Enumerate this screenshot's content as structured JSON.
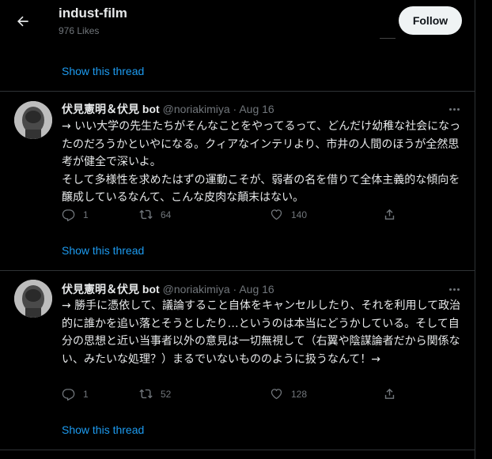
{
  "header": {
    "title": "indust-film",
    "likes": "976 Likes",
    "follow_label": "Follow"
  },
  "top": {
    "show_thread": "Show this thread"
  },
  "tweets": [
    {
      "name": "伏見憲明＆伏見 bot",
      "handle": "@noriakimiya · Aug 16",
      "text": "→ いい大学の先生たちがそんなことをやってるって、どんだけ幼稚な社会になったのだろうかといやになる。クィアなインテリより、市井の人間のほうが全然思考が健全で深いよ。\nそして多様性を求めたはずの運動こそが、弱者の名を借りて全体主義的な傾向を醸成しているなんて、こんな皮肉な顛末はない。",
      "reply_count": "1",
      "retweet_count": "64",
      "like_count": "140",
      "show_thread": "Show this thread"
    },
    {
      "name": "伏見憲明＆伏見 bot",
      "handle": "@noriakimiya · Aug 16",
      "text": "→ 勝手に憑依して、議論すること自体をキャンセルしたり、それを利用して政治的に誰かを追い落とそうとしたり…というのは本当にどうかしている。そして自分の思想と近い当事者以外の意見は一切無視して（右翼や陰謀論者だから関係ない、みたいな処理？）まるでいないもののように扱うなんて！→",
      "reply_count": "1",
      "retweet_count": "52",
      "like_count": "128",
      "show_thread": "Show this thread"
    }
  ],
  "icons": [
    "back-arrow-icon",
    "reply-icon",
    "retweet-icon",
    "like-icon",
    "share-icon",
    "more-icon"
  ],
  "colors": {
    "background": "#000000",
    "accent": "#1d9bf0",
    "muted": "#71767b",
    "text": "#e7e9ea",
    "border": "#2f3336"
  }
}
